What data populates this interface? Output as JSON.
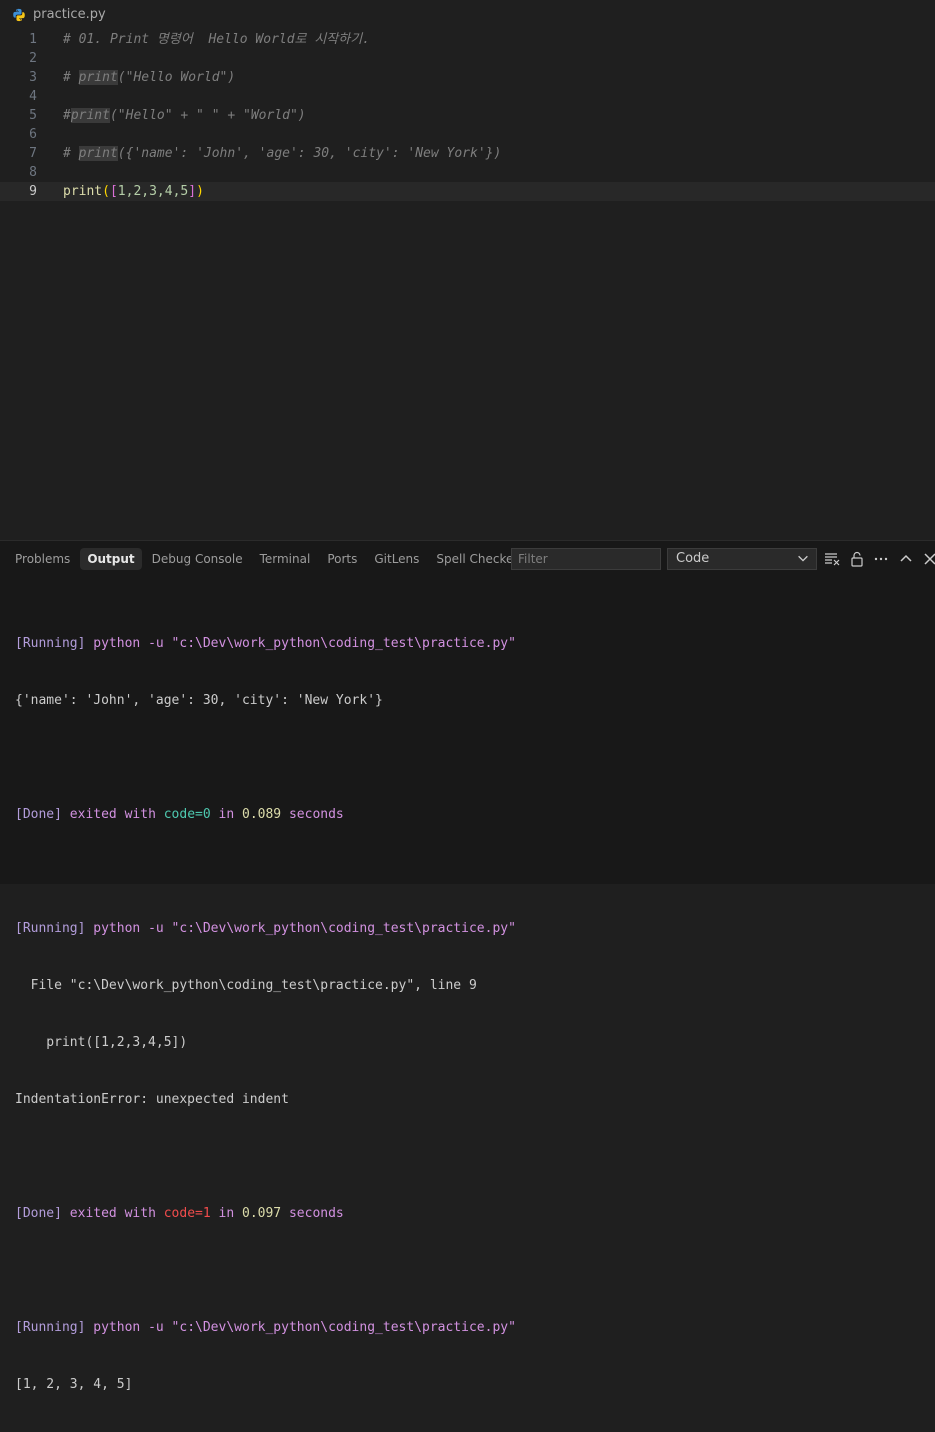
{
  "breadcrumb": {
    "file": "practice.py",
    "icon": "python-icon"
  },
  "editor": {
    "lines": [
      {
        "n": "1",
        "text": "# 01. Print 명령어  Hello World로 시작하기."
      },
      {
        "n": "2",
        "text": ""
      },
      {
        "n": "3",
        "prefix": "# ",
        "fn": "print",
        "rest": "(\"Hello World\")"
      },
      {
        "n": "4",
        "text": ""
      },
      {
        "n": "5",
        "prefix": "#",
        "fn": "print",
        "rest": "(\"Hello\" + \" \" + \"World\")"
      },
      {
        "n": "6",
        "text": ""
      },
      {
        "n": "7",
        "prefix": "# ",
        "fn": "print",
        "rest": "({'name': 'John', 'age': 30, 'city': 'New York'})"
      },
      {
        "n": "8",
        "text": ""
      },
      {
        "n": "9",
        "fn": "print",
        "open1": "(",
        "open2": "[",
        "nums": "1,2,3,4,5",
        "close2": "]",
        "close1": ")"
      }
    ],
    "current_line": "9"
  },
  "panel": {
    "tabs": [
      "Problems",
      "Output",
      "Debug Console",
      "Terminal",
      "Ports",
      "GitLens",
      "Spell Checker"
    ],
    "active_tab": "Output",
    "filter_placeholder": "Filter",
    "channel": "Code"
  },
  "output": {
    "run1": {
      "tag": "[Running]",
      "cmd": "python -u \"c:\\Dev\\work_python\\coding_test\\practice.py\""
    },
    "out1": "{'name': 'John', 'age': 30, 'city': 'New York'}",
    "done1": {
      "tag": "[Done]",
      "mid": "exited with",
      "code": "code=0",
      "in": "in",
      "secs": "0.089",
      "unit": "seconds"
    },
    "run2": {
      "tag": "[Running]",
      "cmd": "python -u \"c:\\Dev\\work_python\\coding_test\\practice.py\""
    },
    "err_line1": "  File \"c:\\Dev\\work_python\\coding_test\\practice.py\", line 9",
    "err_line2": "    print([1,2,3,4,5])",
    "err_line3": "IndentationError: unexpected indent",
    "done2": {
      "tag": "[Done]",
      "mid": "exited with",
      "code": "code=1",
      "in": "in",
      "secs": "0.097",
      "unit": "seconds"
    },
    "run3": {
      "tag": "[Running]",
      "cmd": "python -u \"c:\\Dev\\work_python\\coding_test\\practice.py\""
    },
    "out3": "[1, 2, 3, 4, 5]"
  }
}
